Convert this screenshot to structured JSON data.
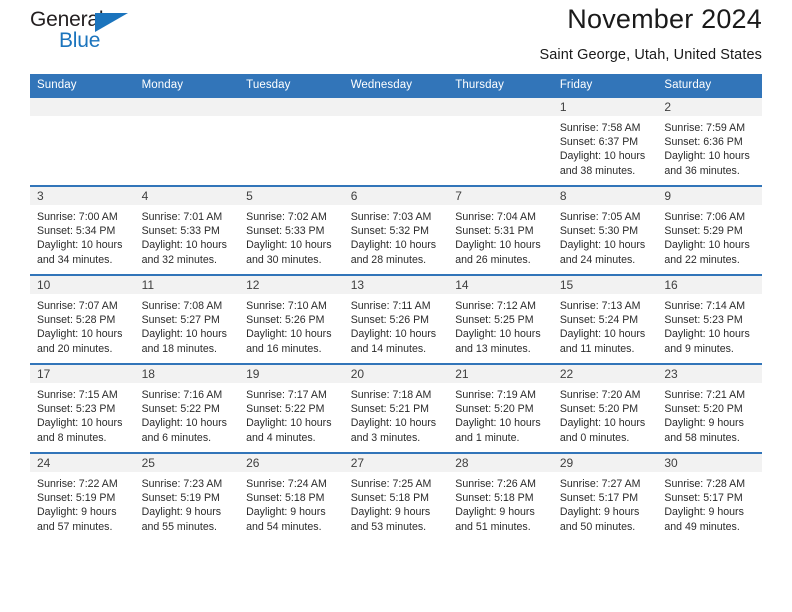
{
  "brand": {
    "name_top": "General",
    "name_bottom": "Blue",
    "accent_color": "#1b74bd"
  },
  "header": {
    "title": "November 2024",
    "subtitle": "Saint George, Utah, United States"
  },
  "theme": {
    "header_blue": "#3275b9",
    "daynum_gray": "#f2f2f2",
    "text_color": "#2b2b2b"
  },
  "calendar": {
    "weekday_headers": [
      "Sunday",
      "Monday",
      "Tuesday",
      "Wednesday",
      "Thursday",
      "Friday",
      "Saturday"
    ],
    "weeks": [
      [
        {
          "day": "",
          "lines": []
        },
        {
          "day": "",
          "lines": []
        },
        {
          "day": "",
          "lines": []
        },
        {
          "day": "",
          "lines": []
        },
        {
          "day": "",
          "lines": []
        },
        {
          "day": "1",
          "lines": [
            "Sunrise: 7:58 AM",
            "Sunset: 6:37 PM",
            "Daylight: 10 hours",
            "and 38 minutes."
          ]
        },
        {
          "day": "2",
          "lines": [
            "Sunrise: 7:59 AM",
            "Sunset: 6:36 PM",
            "Daylight: 10 hours",
            "and 36 minutes."
          ]
        }
      ],
      [
        {
          "day": "3",
          "lines": [
            "Sunrise: 7:00 AM",
            "Sunset: 5:34 PM",
            "Daylight: 10 hours",
            "and 34 minutes."
          ]
        },
        {
          "day": "4",
          "lines": [
            "Sunrise: 7:01 AM",
            "Sunset: 5:33 PM",
            "Daylight: 10 hours",
            "and 32 minutes."
          ]
        },
        {
          "day": "5",
          "lines": [
            "Sunrise: 7:02 AM",
            "Sunset: 5:33 PM",
            "Daylight: 10 hours",
            "and 30 minutes."
          ]
        },
        {
          "day": "6",
          "lines": [
            "Sunrise: 7:03 AM",
            "Sunset: 5:32 PM",
            "Daylight: 10 hours",
            "and 28 minutes."
          ]
        },
        {
          "day": "7",
          "lines": [
            "Sunrise: 7:04 AM",
            "Sunset: 5:31 PM",
            "Daylight: 10 hours",
            "and 26 minutes."
          ]
        },
        {
          "day": "8",
          "lines": [
            "Sunrise: 7:05 AM",
            "Sunset: 5:30 PM",
            "Daylight: 10 hours",
            "and 24 minutes."
          ]
        },
        {
          "day": "9",
          "lines": [
            "Sunrise: 7:06 AM",
            "Sunset: 5:29 PM",
            "Daylight: 10 hours",
            "and 22 minutes."
          ]
        }
      ],
      [
        {
          "day": "10",
          "lines": [
            "Sunrise: 7:07 AM",
            "Sunset: 5:28 PM",
            "Daylight: 10 hours",
            "and 20 minutes."
          ]
        },
        {
          "day": "11",
          "lines": [
            "Sunrise: 7:08 AM",
            "Sunset: 5:27 PM",
            "Daylight: 10 hours",
            "and 18 minutes."
          ]
        },
        {
          "day": "12",
          "lines": [
            "Sunrise: 7:10 AM",
            "Sunset: 5:26 PM",
            "Daylight: 10 hours",
            "and 16 minutes."
          ]
        },
        {
          "day": "13",
          "lines": [
            "Sunrise: 7:11 AM",
            "Sunset: 5:26 PM",
            "Daylight: 10 hours",
            "and 14 minutes."
          ]
        },
        {
          "day": "14",
          "lines": [
            "Sunrise: 7:12 AM",
            "Sunset: 5:25 PM",
            "Daylight: 10 hours",
            "and 13 minutes."
          ]
        },
        {
          "day": "15",
          "lines": [
            "Sunrise: 7:13 AM",
            "Sunset: 5:24 PM",
            "Daylight: 10 hours",
            "and 11 minutes."
          ]
        },
        {
          "day": "16",
          "lines": [
            "Sunrise: 7:14 AM",
            "Sunset: 5:23 PM",
            "Daylight: 10 hours",
            "and 9 minutes."
          ]
        }
      ],
      [
        {
          "day": "17",
          "lines": [
            "Sunrise: 7:15 AM",
            "Sunset: 5:23 PM",
            "Daylight: 10 hours",
            "and 8 minutes."
          ]
        },
        {
          "day": "18",
          "lines": [
            "Sunrise: 7:16 AM",
            "Sunset: 5:22 PM",
            "Daylight: 10 hours",
            "and 6 minutes."
          ]
        },
        {
          "day": "19",
          "lines": [
            "Sunrise: 7:17 AM",
            "Sunset: 5:22 PM",
            "Daylight: 10 hours",
            "and 4 minutes."
          ]
        },
        {
          "day": "20",
          "lines": [
            "Sunrise: 7:18 AM",
            "Sunset: 5:21 PM",
            "Daylight: 10 hours",
            "and 3 minutes."
          ]
        },
        {
          "day": "21",
          "lines": [
            "Sunrise: 7:19 AM",
            "Sunset: 5:20 PM",
            "Daylight: 10 hours",
            "and 1 minute."
          ]
        },
        {
          "day": "22",
          "lines": [
            "Sunrise: 7:20 AM",
            "Sunset: 5:20 PM",
            "Daylight: 10 hours",
            "and 0 minutes."
          ]
        },
        {
          "day": "23",
          "lines": [
            "Sunrise: 7:21 AM",
            "Sunset: 5:20 PM",
            "Daylight: 9 hours",
            "and 58 minutes."
          ]
        }
      ],
      [
        {
          "day": "24",
          "lines": [
            "Sunrise: 7:22 AM",
            "Sunset: 5:19 PM",
            "Daylight: 9 hours",
            "and 57 minutes."
          ]
        },
        {
          "day": "25",
          "lines": [
            "Sunrise: 7:23 AM",
            "Sunset: 5:19 PM",
            "Daylight: 9 hours",
            "and 55 minutes."
          ]
        },
        {
          "day": "26",
          "lines": [
            "Sunrise: 7:24 AM",
            "Sunset: 5:18 PM",
            "Daylight: 9 hours",
            "and 54 minutes."
          ]
        },
        {
          "day": "27",
          "lines": [
            "Sunrise: 7:25 AM",
            "Sunset: 5:18 PM",
            "Daylight: 9 hours",
            "and 53 minutes."
          ]
        },
        {
          "day": "28",
          "lines": [
            "Sunrise: 7:26 AM",
            "Sunset: 5:18 PM",
            "Daylight: 9 hours",
            "and 51 minutes."
          ]
        },
        {
          "day": "29",
          "lines": [
            "Sunrise: 7:27 AM",
            "Sunset: 5:17 PM",
            "Daylight: 9 hours",
            "and 50 minutes."
          ]
        },
        {
          "day": "30",
          "lines": [
            "Sunrise: 7:28 AM",
            "Sunset: 5:17 PM",
            "Daylight: 9 hours",
            "and 49 minutes."
          ]
        }
      ]
    ]
  }
}
